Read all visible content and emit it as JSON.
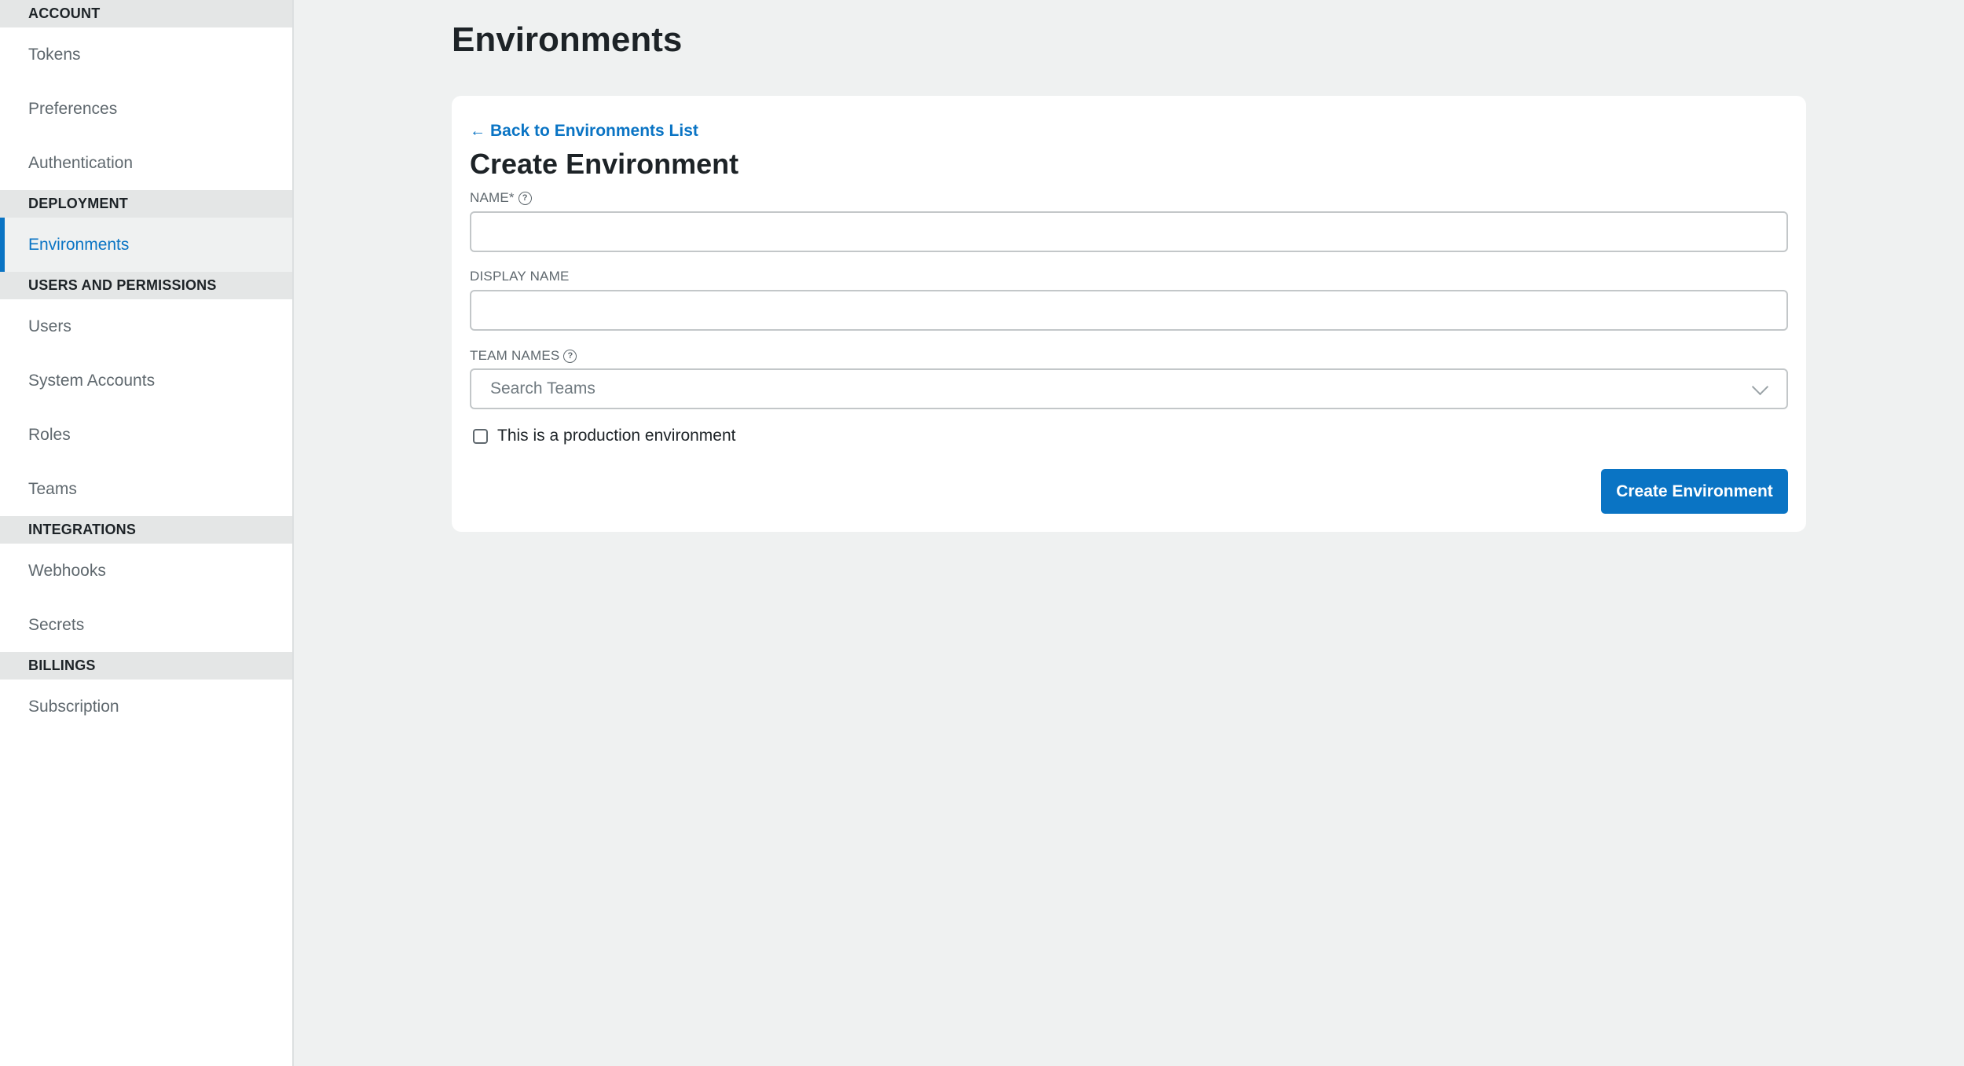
{
  "sidebar": {
    "sections": [
      {
        "header": "ACCOUNT",
        "items": [
          {
            "label": "Tokens",
            "active": false
          },
          {
            "label": "Preferences",
            "active": false
          },
          {
            "label": "Authentication",
            "active": false
          }
        ]
      },
      {
        "header": "DEPLOYMENT",
        "items": [
          {
            "label": "Environments",
            "active": true
          }
        ]
      },
      {
        "header": "USERS AND PERMISSIONS",
        "items": [
          {
            "label": "Users",
            "active": false
          },
          {
            "label": "System Accounts",
            "active": false
          },
          {
            "label": "Roles",
            "active": false
          },
          {
            "label": "Teams",
            "active": false
          }
        ]
      },
      {
        "header": "INTEGRATIONS",
        "items": [
          {
            "label": "Webhooks",
            "active": false
          },
          {
            "label": "Secrets",
            "active": false
          }
        ]
      },
      {
        "header": "BILLINGS",
        "items": [
          {
            "label": "Subscription",
            "active": false
          }
        ]
      }
    ]
  },
  "page": {
    "title": "Environments"
  },
  "form": {
    "back_link": "Back to Environments List",
    "back_icon": "arrow-left-icon",
    "title": "Create Environment",
    "fields": {
      "name": {
        "label": "NAME*",
        "value": "",
        "help_icon": "question-circle-icon"
      },
      "display_name": {
        "label": "DISPLAY NAME",
        "value": ""
      },
      "team_names": {
        "label": "TEAM NAMES",
        "placeholder": "Search Teams",
        "help_icon": "question-circle-icon"
      }
    },
    "production_checkbox": {
      "label": "This is a production environment",
      "checked": false
    },
    "submit_label": "Create Environment"
  },
  "colors": {
    "accent": "#0a74c4",
    "background": "#eff1f1",
    "section_header_bg": "#e4e6e6"
  }
}
